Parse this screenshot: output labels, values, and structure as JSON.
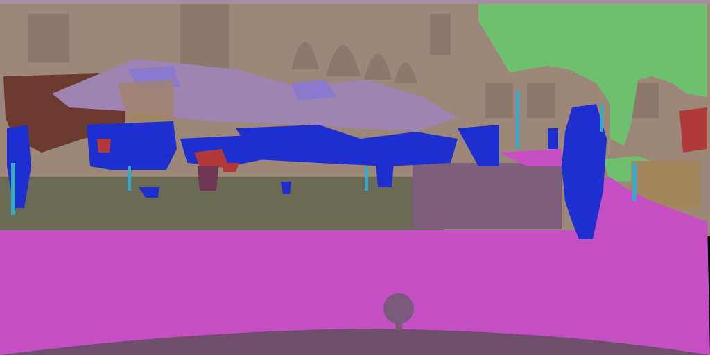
{
  "image": {
    "kind": "semantic segmentation overlay of a street scene",
    "visible_text": []
  },
  "palette": {
    "building": "#9c8778",
    "building_shadow": "#8a7668",
    "sky": "#a48ea0",
    "vegetation": "#6fc06e",
    "terrain": "#6a6a55",
    "sidewalk": "#c64fc4",
    "road": "#7e5c7c",
    "person": "#1f2fcf",
    "rider": "#b03a3a",
    "pole": "#38a9c8",
    "umbrella": "#9f84b2",
    "umbrella_top": "#8a7bcf",
    "awning": "#6b3a2f",
    "car_hood": "#6e4e6c",
    "wall": "#a4865e",
    "vehicle": "#6d3550"
  },
  "classes": [
    {
      "id": "building",
      "label": "building"
    },
    {
      "id": "sky",
      "label": "sky"
    },
    {
      "id": "vegetation",
      "label": "vegetation"
    },
    {
      "id": "terrain",
      "label": "terrain"
    },
    {
      "id": "sidewalk",
      "label": "sidewalk"
    },
    {
      "id": "road",
      "label": "road"
    },
    {
      "id": "person",
      "label": "person"
    },
    {
      "id": "rider",
      "label": "rider"
    },
    {
      "id": "pole",
      "label": "pole"
    },
    {
      "id": "umbrella",
      "label": "umbrella"
    }
  ]
}
